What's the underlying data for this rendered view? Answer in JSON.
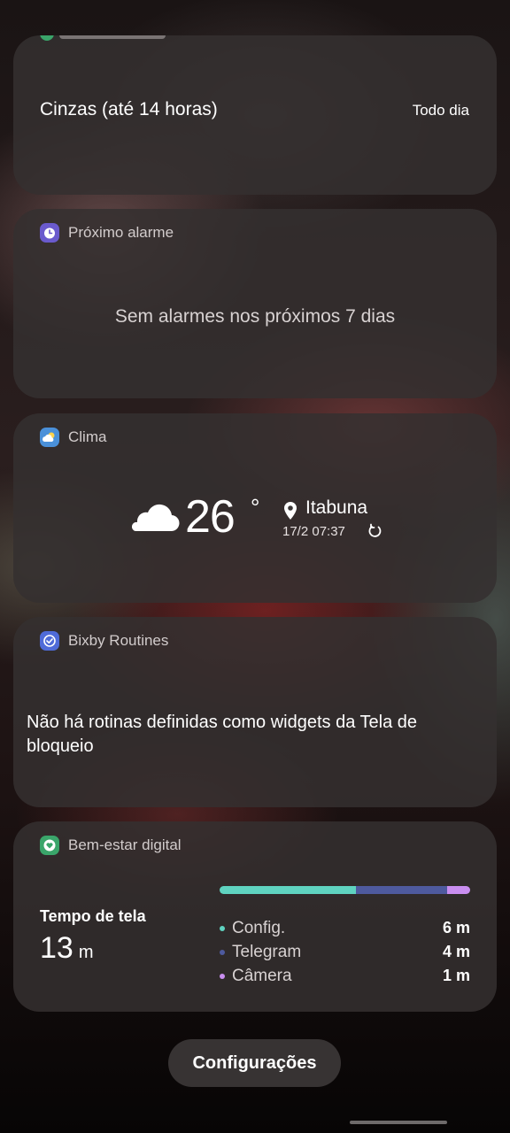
{
  "colors": {
    "card_bg": "#343030",
    "alarm_icon": "#6a5acd",
    "weather_icon": "#4a90d9",
    "bixby_icon": "#4f6bd8",
    "wellbeing_icon": "#3aa56a"
  },
  "events_card": {
    "event_name": "Cinzas (até 14 horas)",
    "event_when": "Todo dia"
  },
  "alarm_card": {
    "title": "Próximo alarme",
    "icon": "alarm-clock-icon",
    "message": "Sem alarmes nos próximos 7 dias"
  },
  "weather_card": {
    "title": "Clima",
    "icon": "weather-icon",
    "condition_icon": "cloud-icon",
    "temperature": "26",
    "degree_symbol": "°",
    "city": "Itabuna",
    "updated": "17/2 07:37"
  },
  "bixby_card": {
    "title": "Bixby Routines",
    "icon": "bixby-routines-icon",
    "message": "Não há rotinas definidas como widgets da Tela de bloqueio"
  },
  "wellbeing_card": {
    "title": "Bem-estar digital",
    "icon": "heart-icon",
    "screen_time_label": "Tempo de tela",
    "screen_time_value": "13",
    "screen_time_unit": "m",
    "apps": [
      {
        "name": "Config.",
        "time": "6 m",
        "minutes": 6,
        "color": "#5fd3c0"
      },
      {
        "name": "Telegram",
        "time": "4 m",
        "minutes": 4,
        "color": "#4e5a9e"
      },
      {
        "name": "Câmera",
        "time": "1 m",
        "minutes": 1,
        "color": "#c98ef0"
      }
    ]
  },
  "settings_button": {
    "label": "Configurações"
  }
}
